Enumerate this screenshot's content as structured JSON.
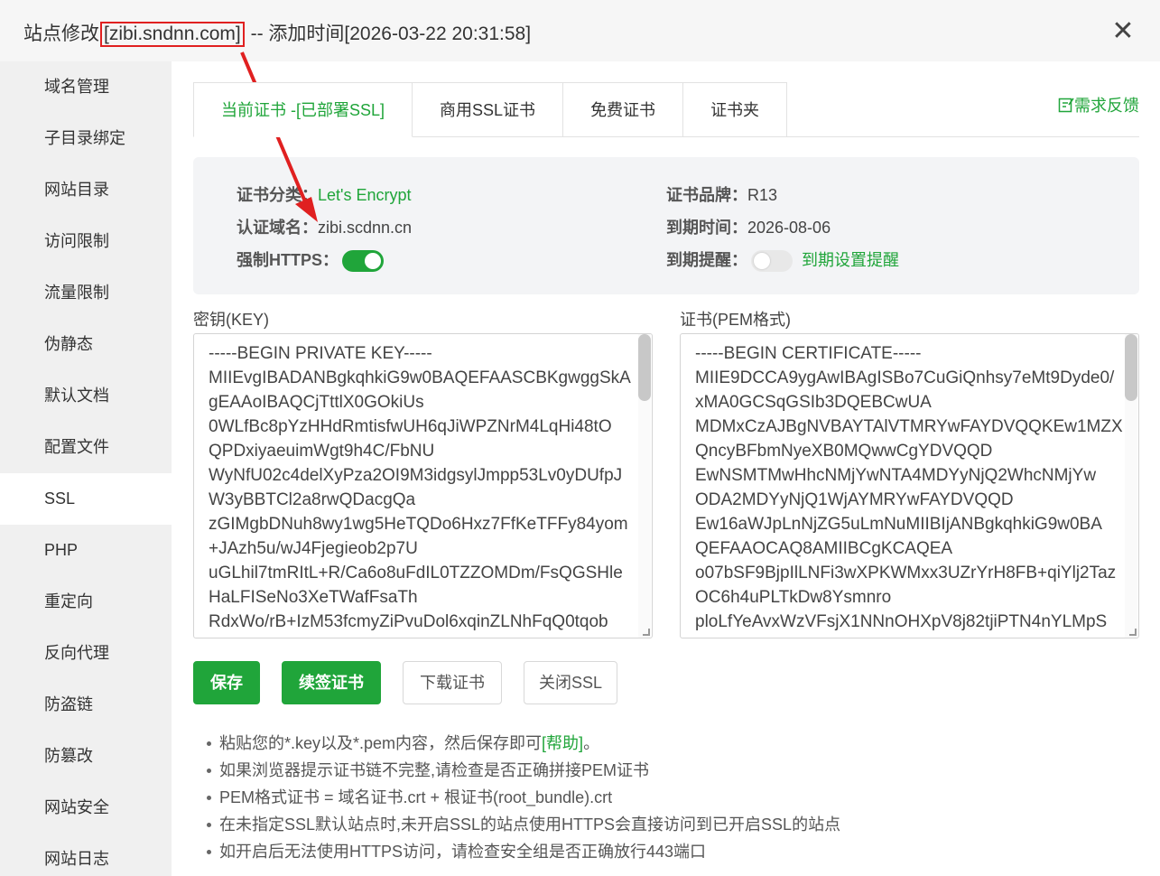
{
  "window": {
    "title_prefix": "站点修改",
    "title_domain": "[zibi.sndnn.com]",
    "title_suffix": " -- 添加时间[2026-03-22 20:31:58]",
    "close_glyph": "✕"
  },
  "sidebar": {
    "items": [
      {
        "label": "域名管理"
      },
      {
        "label": "子目录绑定"
      },
      {
        "label": "网站目录"
      },
      {
        "label": "访问限制"
      },
      {
        "label": "流量限制"
      },
      {
        "label": "伪静态"
      },
      {
        "label": "默认文档"
      },
      {
        "label": "配置文件"
      },
      {
        "label": "SSL"
      },
      {
        "label": "PHP"
      },
      {
        "label": "重定向"
      },
      {
        "label": "反向代理"
      },
      {
        "label": "防盗链"
      },
      {
        "label": "防篡改"
      },
      {
        "label": "网站安全"
      },
      {
        "label": "网站日志"
      }
    ],
    "active_index": 8
  },
  "tabs": [
    {
      "label": "当前证书 -[已部署SSL]"
    },
    {
      "label": "商用SSL证书"
    },
    {
      "label": "免费证书"
    },
    {
      "label": "证书夹"
    }
  ],
  "feedback": {
    "label": "需求反馈"
  },
  "cert_info": {
    "category_label": "证书分类：",
    "category_value": "Let's Encrypt",
    "domain_label": "认证域名：",
    "domain_value": "zibi.scdnn.cn",
    "https_label": "强制HTTPS：",
    "https_on": true,
    "brand_label": "证书品牌：",
    "brand_value": "R13",
    "expire_label": "到期时间：",
    "expire_value": "2026-08-06",
    "remind_label": "到期提醒：",
    "remind_on": false,
    "remind_link": "到期设置提醒"
  },
  "key_panel": {
    "label": "密钥(KEY)",
    "content": "-----BEGIN PRIVATE KEY-----\nMIIEvgIBADANBgkqhkiG9w0BAQEFAASCBKgwggSkA\ngEAAoIBAQCjTttlX0GOkiUs\n0WLfBc8pYzHHdRmtisfwUH6qJiWPZNrM4LqHi48tO\nQPDxiyaeuimWgt9h4C/FbNU\nWyNfU02c4delXyPza2OI9M3idgsylJmpp53Lv0yDUfpJ\nW3yBBTCl2a8rwQDacgQa\nzGIMgbDNuh8wy1wg5HeTQDo6Hxz7FfKeTFFy84yom\n+JAzh5u/wJ4Fjegieob2p7U\nuGLhil7tmRItL+R/Ca6o8uFdIL0TZZOMDm/FsQGSHle\nHaLFISeNo3XeTWafFsaTh\nRdxWo/rB+IzM53fcmyZiPvuDol6xqinZLNhFqQ0tqob"
  },
  "cert_panel": {
    "label": "证书(PEM格式)",
    "content": "-----BEGIN CERTIFICATE-----\nMIIE9DCCA9ygAwIBAgISBo7CuGiQnhsy7eMt9Dyde0/\nxMA0GCSqGSIb3DQEBCwUA\nMDMxCzAJBgNVBAYTAlVTMRYwFAYDVQQKEw1MZX\nQncyBFbmNyeXB0MQwwCgYDVQQD\nEwNSMTMwHhcNMjYwNTA4MDYyNjQ2WhcNMjYw\nODA2MDYyNjQ1WjAYMRYwFAYDVQQD\nEw16aWJpLnNjZG5uLmNuMIIBIjANBgkqhkiG9w0BA\nQEFAAOCAQ8AMIIBCgKCAQEA\no07bSF9BjpIlLNFi3wXPKWMxx3UZrYrH8FB+qiYlj2Taz\nOC6h4uPLTkDw8Ysmnro\nploLfYeAvxWzVFsjX1NNnOHXpV8j82tjiPTN4nYLMpS"
  },
  "buttons": {
    "save": "保存",
    "renew": "续签证书",
    "download": "下载证书",
    "close_ssl": "关闭SSL"
  },
  "tips": {
    "tip1_a": "粘贴您的*.key以及*.pem内容，然后保存即可",
    "tip1_help": "[帮助]",
    "tip1_b": "。",
    "tip2": "如果浏览器提示证书链不完整,请检查是否正确拼接PEM证书",
    "tip3": "PEM格式证书 = 域名证书.crt + 根证书(root_bundle).crt",
    "tip4": "在未指定SSL默认站点时,未开启SSL的站点使用HTTPS会直接访问到已开启SSL的站点",
    "tip5": "如开启后无法使用HTTPS访问，请检查安全组是否正确放行443端口"
  },
  "colors": {
    "accent": "#20a53a",
    "annotation": "#e02020"
  }
}
